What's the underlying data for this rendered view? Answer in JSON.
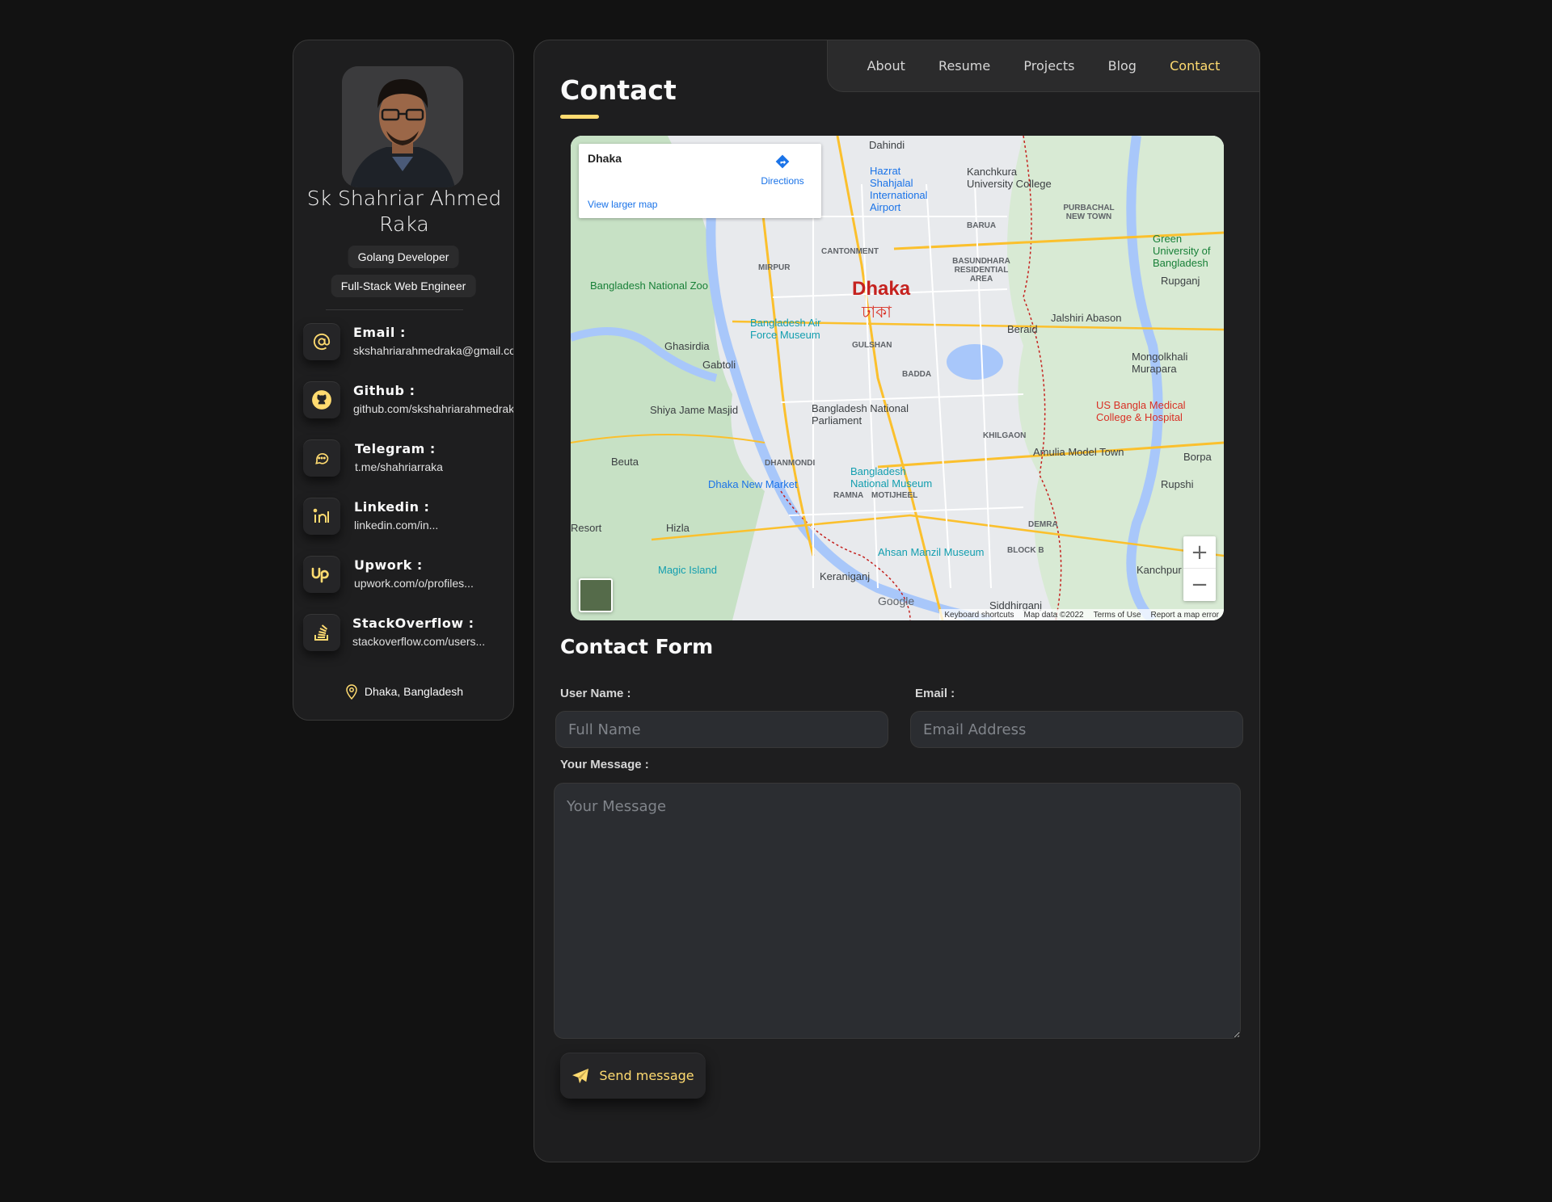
{
  "profile": {
    "name": "Sk Shahriar Ahmed Raka",
    "titles": [
      "Golang Developer",
      "Full-Stack Web Engineer"
    ],
    "location": "Dhaka, Bangladesh"
  },
  "contacts": [
    {
      "label": "Email :",
      "value": "skshahriarahmedraka@gmail.com",
      "icon": "at-icon"
    },
    {
      "label": "Github :",
      "value": "github.com/skshahriarahmedraka",
      "icon": "github-icon"
    },
    {
      "label": "Telegram :",
      "value": "t.me/shahriarraka",
      "icon": "chat-icon"
    },
    {
      "label": "Linkedin :",
      "value": "linkedin.com/in...",
      "icon": "linkedin-icon"
    },
    {
      "label": "Upwork :",
      "value": "upwork.com/o/profiles...",
      "icon": "upwork-icon"
    },
    {
      "label": "StackOverflow :",
      "value": "stackoverflow.com/users...",
      "icon": "stackoverflow-icon"
    }
  ],
  "nav": {
    "items": [
      "About",
      "Resume",
      "Projects",
      "Blog",
      "Contact"
    ],
    "active": "Contact"
  },
  "page": {
    "title": "Contact"
  },
  "map": {
    "place": "Dhaka",
    "directions": "Directions",
    "larger": "View larger map",
    "city_en": "Dhaka",
    "city_bn": "ঢাকা",
    "labels": {
      "zoo": "Bangladesh National Zoo",
      "mirpur": "MIRPUR",
      "cantonment": "CANTONMENT",
      "airport": "Hazrat Shahjalal International Airport",
      "kanchkura": "Kanchkura University College",
      "air_museum": "Bangladesh Air Force Museum",
      "gulshan": "GULSHAN",
      "bashundhara": "BASUNDHARA RESIDENTIAL AREA",
      "beraid": "Beraid",
      "jalshiri": "Jalshiri Abason",
      "rupganj": "Rupganj",
      "ghasirdia": "Ghasirdia",
      "gabtoli": "Gabtoli",
      "shiya": "Shiya Jame Masjid",
      "parliament": "Bangladesh National Parliament",
      "badda": "BADDA",
      "mongolkhali": "Mongolkhali Murapara",
      "usbangla": "US Bangla Medical College & Hospital",
      "khilgaon": "KHILGAON",
      "amulia": "Amulia Model Town",
      "borpa": "Borpa",
      "rupshi": "Rupshi",
      "dhanmondi": "DHANMONDI",
      "new_market": "Dhaka New Market",
      "national_museum": "Bangladesh National Museum",
      "ramna": "RAMNA",
      "motijheel": "MOTIJHEEL",
      "beuta": "Beuta",
      "hizla": "Hizla",
      "magic": "Magic Island",
      "ahsan": "Ahsan Manzil Museum",
      "keraniganj": "Keraniganj",
      "demra": "DEMRA",
      "kanchpur": "Kanchpur",
      "siddhirganj": "Siddhirganj",
      "dahindi": "Dahindi",
      "barua": "BARUA",
      "purbachal": "PURBACHAL NEW TOWN",
      "green_univ": "Green University of Bangladesh",
      "resort": "Resort",
      "block_b": "BLOCK B"
    },
    "footer": [
      "Keyboard shortcuts",
      "Map data ©2022",
      "Terms of Use",
      "Report a map error"
    ],
    "google": "Google",
    "zoom_in": "+",
    "zoom_out": "−"
  },
  "form": {
    "title": "Contact Form",
    "username_label": "User Name :",
    "username_placeholder": "Full Name",
    "email_label": "Email :",
    "email_placeholder": "Email Address",
    "message_label": "Your Message :",
    "message_placeholder": "Your Message",
    "send_label": "Send message"
  },
  "colors": {
    "accent": "#ffdb70",
    "bg": "#121212",
    "panel": "#1e1e1f"
  }
}
